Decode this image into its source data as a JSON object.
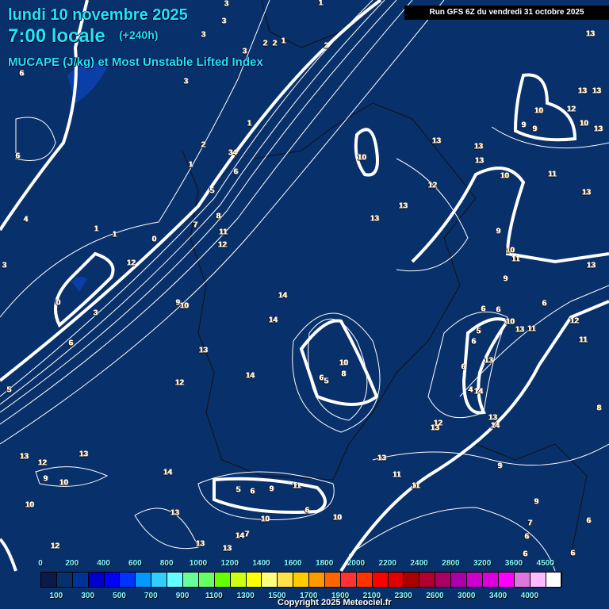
{
  "header": {
    "date": "lundi 10 novembre 2025",
    "time": "7:00 locale",
    "lead": "(+240h)",
    "parameter": "MUCAPE (J/kg) et Most Unstable Lifted Index",
    "run": "Run GFS 6Z du vendredi 31 octobre 2025"
  },
  "map": {
    "labels": [
      "3",
      "1",
      "3",
      "3",
      "2",
      "2",
      "1",
      "2",
      "3",
      "6",
      "3",
      "13",
      "13",
      "13",
      "10",
      "12",
      "9",
      "9",
      "10",
      "13",
      "1",
      "2",
      "34",
      "6",
      "10",
      "13",
      "13",
      "13",
      "6",
      "1",
      "11",
      "10",
      "12",
      "13",
      "5",
      "13",
      "13",
      "8",
      "4",
      "7",
      "1",
      "1",
      "0",
      "11",
      "12",
      "9",
      "10",
      "11",
      "12",
      "13",
      "3",
      "9",
      "14",
      "0",
      "9",
      "10",
      "3",
      "6",
      "6",
      "6",
      "14",
      "10",
      "13",
      "11",
      "12",
      "5",
      "6",
      "6",
      "13",
      "11",
      "10",
      "13",
      "6",
      "6",
      "5",
      "8",
      "14",
      "12",
      "5",
      "4",
      "14",
      "8",
      "13",
      "12",
      "14",
      "13",
      "13",
      "13",
      "12",
      "13",
      "9",
      "14",
      "9",
      "10",
      "11",
      "11",
      "11",
      "5",
      "6",
      "9",
      "6",
      "10",
      "10",
      "9",
      "10",
      "13",
      "7",
      "6",
      "14",
      "7",
      "6",
      "13",
      "13",
      "12",
      "6",
      "6"
    ]
  },
  "legend": {
    "colors": [
      "#0a1a4a",
      "#08306b",
      "#003399",
      "#0000cc",
      "#0000ff",
      "#0033ff",
      "#0099ff",
      "#33ccff",
      "#66ffff",
      "#66ff99",
      "#66ff66",
      "#66ff00",
      "#ccff11",
      "#ffff00",
      "#ffff80",
      "#ffe14a",
      "#ffcc00",
      "#ff9900",
      "#ff6600",
      "#ff3333",
      "#ff3300",
      "#ff0000",
      "#e00000",
      "#aa0000",
      "#b00030",
      "#aa0066",
      "#aa00aa",
      "#cc00cc",
      "#dd00dd",
      "#ff00ff",
      "#dd77dd",
      "#ffbbff",
      "#ffffff"
    ],
    "top_labels": [
      "0",
      "200",
      "400",
      "600",
      "800",
      "1000",
      "1200",
      "1400",
      "1600",
      "1800",
      "2000",
      "2200",
      "2400",
      "2800",
      "3200",
      "3600",
      "4500"
    ],
    "bottom_labels": [
      "100",
      "300",
      "500",
      "700",
      "900",
      "1100",
      "1300",
      "1500",
      "1700",
      "1900",
      "2100",
      "2300",
      "2600",
      "3000",
      "3400",
      "4000"
    ]
  },
  "copyright": "Copyright 2025 Meteociel.fr"
}
